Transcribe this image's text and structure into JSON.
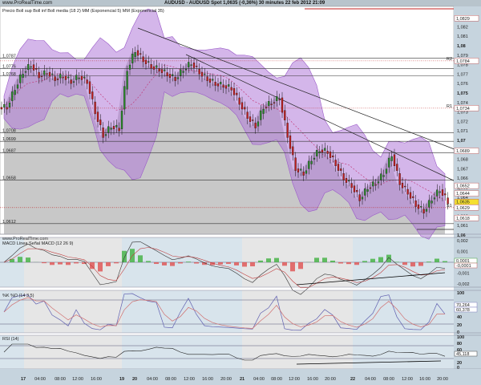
{
  "header": {
    "site": "www.ProRealTime.com",
    "title": "AUDUSD - AUDUSD Spot   1,0635 (-0,36%)   30 minutes  22 feb 2012 21:09"
  },
  "main": {
    "legend": "Precio Boll sup Boll inf Boll media (18 2) MM (Exponencial 5) MM (Exponencial 35)",
    "left_levels": [
      "1,0787",
      "1,0776",
      "1,0768",
      "1,0708",
      "1,0699",
      "1,0687",
      "1,0658",
      "1,0612"
    ],
    "axis_ticks": [
      "1,083",
      "1,082",
      "1,081",
      "1,08",
      "1,079",
      "1,078",
      "1,077",
      "1,076",
      "1,075",
      "1,074",
      "1,073",
      "1,072",
      "1,071",
      "1,07",
      "1,069",
      "1,068",
      "1,067",
      "1,066",
      "1,065",
      "1,064",
      "1,063",
      "1,062",
      "1,061",
      "1,06"
    ],
    "axis_tags": {
      "top": "1,0829",
      "r2": "1,0784",
      "r1": "1,0734",
      "l1": "1,0689",
      "l2": "1,0652",
      "l3": "1,0644",
      "last": "1,0635",
      "s1": "1,0629",
      "l4": "1,0618"
    },
    "pivot_labels": {
      "r2": "R2",
      "r1": "R1",
      "s1": "S1"
    }
  },
  "macd": {
    "legend": "MACD Línea Señal MACD (12 26 9)",
    "ticks": [
      "0,002",
      "0,001",
      "-0,001",
      "-0,002"
    ],
    "tags": [
      "0,0001",
      "-0,0001"
    ]
  },
  "stoch": {
    "legend": "%K %D (14 3 5)",
    "ticks": [
      "100",
      "40",
      "20",
      "0"
    ],
    "tags": [
      "70,264",
      "60,378"
    ]
  },
  "rsi": {
    "legend": "RSI (14)",
    "ticks": [
      "100",
      "80",
      "60",
      "20",
      "0"
    ],
    "tags": [
      "45,118"
    ]
  },
  "time_axis": [
    "17",
    "04:00",
    "08:00",
    "12:00",
    "16:00",
    "19",
    "20",
    "04:00",
    "08:00",
    "12:00",
    "16:00",
    "20:00",
    "21",
    "04:00",
    "08:00",
    "12:00",
    "16:00",
    "20:00",
    "22",
    "04:00",
    "08:00",
    "12:00",
    "16:00",
    "20:00"
  ],
  "chart_data": {
    "type": "line",
    "title": "AUDUSD - AUDUSD Spot 30 minutes",
    "ylim": [
      1.06,
      1.083
    ],
    "closes": [
      1.0735,
      1.0755,
      1.0772,
      1.078,
      1.0768,
      1.0772,
      1.0765,
      1.0768,
      1.0762,
      1.0768,
      1.0762,
      1.073,
      1.0705,
      1.0715,
      1.0712,
      1.0775,
      1.0795,
      1.0785,
      1.0778,
      1.0775,
      1.077,
      1.0765,
      1.0775,
      1.0782,
      1.0772,
      1.0765,
      1.076,
      1.0758,
      1.0755,
      1.074,
      1.0725,
      1.0715,
      1.0735,
      1.074,
      1.0745,
      1.0705,
      1.067,
      1.0665,
      1.068,
      1.069,
      1.0688,
      1.0675,
      1.066,
      1.0652,
      1.0638,
      1.065,
      1.0655,
      1.0665,
      1.0685,
      1.0655,
      1.0645,
      1.0632,
      1.0625,
      1.0638,
      1.0648,
      1.0635
    ],
    "colors": {
      "band": "#b07ad8",
      "up": "#2a8a2a",
      "down": "#c02020",
      "macd_pos": "#40b040",
      "macd_neg": "#e05050"
    }
  }
}
